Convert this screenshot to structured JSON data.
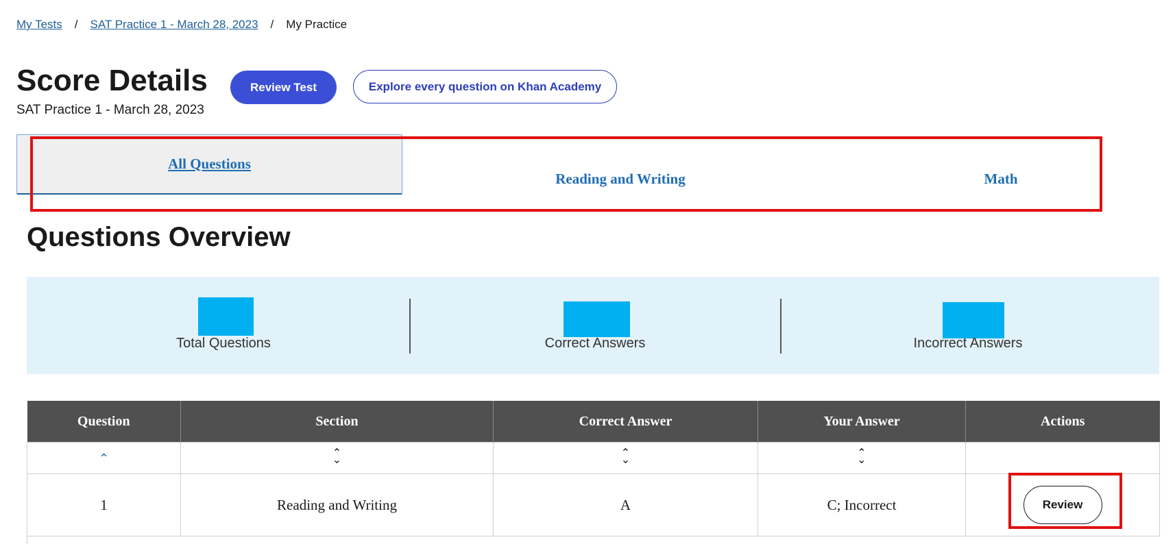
{
  "breadcrumb": {
    "items": [
      {
        "label": "My Tests",
        "link": true
      },
      {
        "label": "SAT Practice 1 - March 28, 2023",
        "link": true
      },
      {
        "label": "My Practice",
        "link": false
      }
    ],
    "separator": "/"
  },
  "header": {
    "title": "Score Details",
    "subtitle": "SAT Practice 1 - March 28, 2023",
    "review_test_label": "Review Test",
    "explore_label": "Explore every question on Khan Academy"
  },
  "tabs": [
    {
      "label": "All Questions",
      "active": true
    },
    {
      "label": "Reading and Writing",
      "active": false
    },
    {
      "label": "Math",
      "active": false
    }
  ],
  "overview": {
    "title": "Questions Overview",
    "stats": [
      {
        "label": "Total Questions",
        "value_hidden": true
      },
      {
        "label": "Correct Answers",
        "value_hidden": true
      },
      {
        "label": "Incorrect Answers",
        "value_hidden": true
      }
    ]
  },
  "table": {
    "columns": [
      "Question",
      "Section",
      "Correct Answer",
      "Your Answer",
      "Actions"
    ],
    "rows": [
      {
        "question": "1",
        "section": "Reading and Writing",
        "correct_answer": "A",
        "your_answer": "C; Incorrect",
        "action": "Review"
      }
    ]
  },
  "colors": {
    "accent": "#3a4fd6",
    "link": "#1f5f99",
    "tab": "#1f6db3",
    "stats_bg": "#e2f2fa",
    "stat_box": "#00b0f0",
    "table_header": "#505050",
    "incorrect": "#8b1a1a",
    "highlight": "#e01010"
  },
  "icons": {
    "sort_active": "chevron-up-icon",
    "sort_inactive": "sort-icon"
  }
}
